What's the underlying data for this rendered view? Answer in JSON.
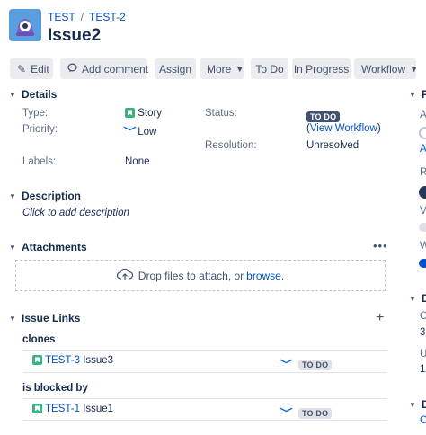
{
  "breadcrumb": {
    "project": "TEST",
    "issue_key": "TEST-2"
  },
  "issue": {
    "title": "Issue2"
  },
  "toolbar": {
    "edit": "Edit",
    "add_comment": "Add comment",
    "assign": "Assign",
    "more": "More",
    "to_do": "To Do",
    "in_progress": "In Progress",
    "workflow": "Workflow"
  },
  "details": {
    "heading": "Details",
    "type_label": "Type:",
    "type_value": "Story",
    "priority_label": "Priority:",
    "priority_value": "Low",
    "labels_label": "Labels:",
    "labels_value": "None",
    "status_label": "Status:",
    "status_value": "TO DO",
    "view_workflow_open": "(",
    "view_workflow": "View Workflow",
    "view_workflow_close": ")",
    "resolution_label": "Resolution:",
    "resolution_value": "Unresolved"
  },
  "description": {
    "heading": "Description",
    "placeholder": "Click to add description"
  },
  "attachments": {
    "heading": "Attachments",
    "drop_text": "Drop files to attach, or ",
    "browse": "browse",
    "period": "."
  },
  "issue_links": {
    "heading": "Issue Links",
    "groups": [
      {
        "relation": "clones",
        "key": "TEST-3",
        "summary": "Issue3",
        "status": "TO DO"
      },
      {
        "relation": "is blocked by",
        "key": "TEST-1",
        "summary": "Issue1",
        "status": "TO DO"
      }
    ]
  },
  "right_panel": {
    "heading_p": "P",
    "a1": "A",
    "a2": "A",
    "r": "R",
    "v": "V",
    "w": "W",
    "heading_d1": "D",
    "c": "C",
    "n3": "3",
    "u": "U",
    "n1": "1",
    "heading_d2": "D",
    "c2": "C"
  },
  "colors": {
    "accent": "#0052cc",
    "story": "#36b37e",
    "avatar": "#5a9ee0"
  }
}
